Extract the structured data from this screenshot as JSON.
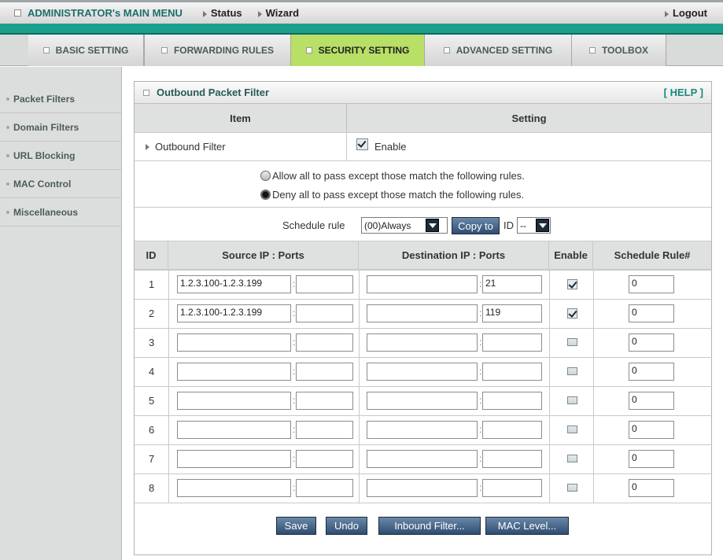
{
  "top_menu": {
    "title": "ADMINISTRATOR's MAIN MENU",
    "status": "Status",
    "wizard": "Wizard",
    "logout": "Logout"
  },
  "tabs": [
    {
      "label": "BASIC SETTING"
    },
    {
      "label": "FORWARDING RULES"
    },
    {
      "label": "SECURITY SETTING"
    },
    {
      "label": "ADVANCED SETTING"
    },
    {
      "label": "TOOLBOX"
    }
  ],
  "sidebar": {
    "items": [
      {
        "label": "Packet Filters"
      },
      {
        "label": "Domain Filters"
      },
      {
        "label": "URL Blocking"
      },
      {
        "label": "MAC Control"
      },
      {
        "label": "Miscellaneous"
      }
    ]
  },
  "panel": {
    "title": "Outbound Packet Filter",
    "help": "[ HELP ]"
  },
  "settings": {
    "item_header": "Item",
    "setting_header": "Setting",
    "filter_label": "Outbound Filter",
    "enable_label": "Enable",
    "enabled": true
  },
  "policy": {
    "allow_text": "Allow all to pass except those match the following rules.",
    "deny_text": "Deny all to pass except those match the following rules.",
    "selected": "deny"
  },
  "schedule": {
    "label": "Schedule rule",
    "selected": "(00)Always",
    "copy_button": "Copy to",
    "id_label": "ID",
    "id_selected": "--"
  },
  "rules_header": {
    "id": "ID",
    "source": "Source IP : Ports",
    "destination": "Destination IP : Ports",
    "enable": "Enable",
    "schedule": "Schedule Rule#"
  },
  "rules": [
    {
      "id": "1",
      "src_ip": "1.2.3.100-1.2.3.199",
      "src_port": "",
      "dst_ip": "",
      "dst_port": "21",
      "enabled": true,
      "schedule": "0"
    },
    {
      "id": "2",
      "src_ip": "1.2.3.100-1.2.3.199",
      "src_port": "",
      "dst_ip": "",
      "dst_port": "119",
      "enabled": true,
      "schedule": "0"
    },
    {
      "id": "3",
      "src_ip": "",
      "src_port": "",
      "dst_ip": "",
      "dst_port": "",
      "enabled": false,
      "schedule": "0"
    },
    {
      "id": "4",
      "src_ip": "",
      "src_port": "",
      "dst_ip": "",
      "dst_port": "",
      "enabled": false,
      "schedule": "0"
    },
    {
      "id": "5",
      "src_ip": "",
      "src_port": "",
      "dst_ip": "",
      "dst_port": "",
      "enabled": false,
      "schedule": "0"
    },
    {
      "id": "6",
      "src_ip": "",
      "src_port": "",
      "dst_ip": "",
      "dst_port": "",
      "enabled": false,
      "schedule": "0"
    },
    {
      "id": "7",
      "src_ip": "",
      "src_port": "",
      "dst_ip": "",
      "dst_port": "",
      "enabled": false,
      "schedule": "0"
    },
    {
      "id": "8",
      "src_ip": "",
      "src_port": "",
      "dst_ip": "",
      "dst_port": "",
      "enabled": false,
      "schedule": "0"
    }
  ],
  "buttons": {
    "save": "Save",
    "undo": "Undo",
    "inbound": "Inbound Filter...",
    "mac": "MAC Level..."
  }
}
